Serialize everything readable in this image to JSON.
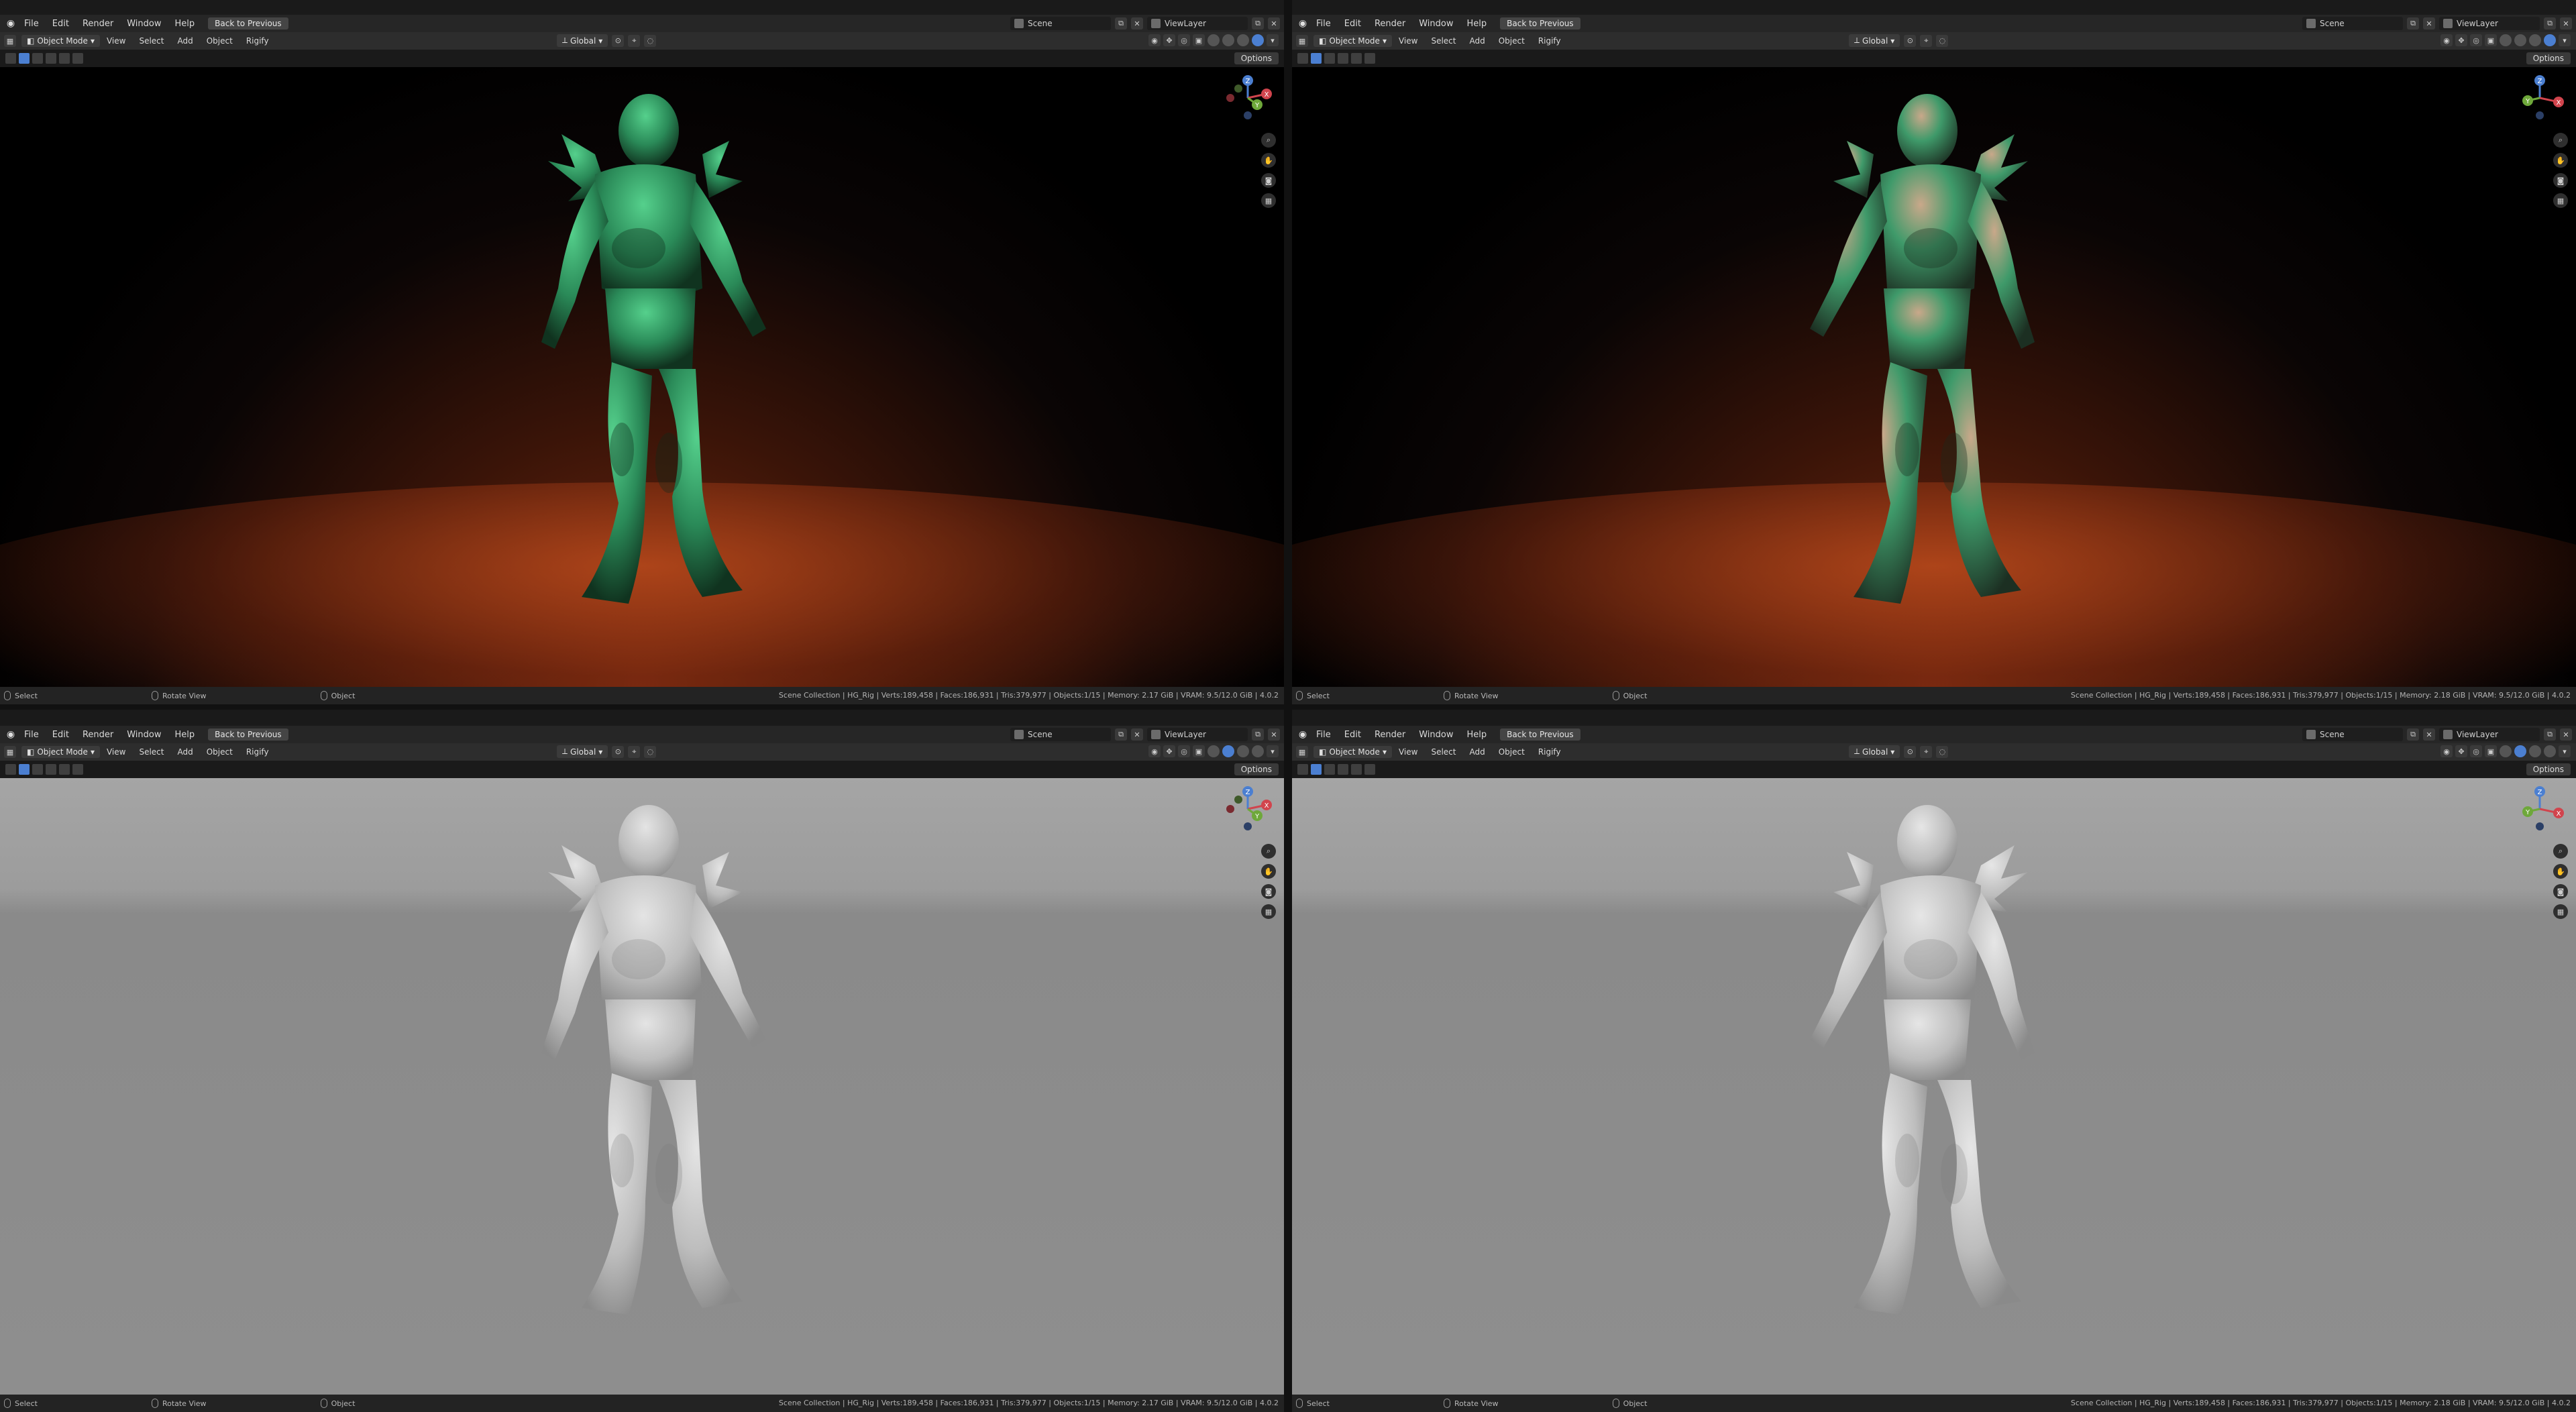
{
  "menu": {
    "file": "File",
    "edit": "Edit",
    "render": "Render",
    "window": "Window",
    "help": "Help",
    "back_to_previous": "Back to Previous"
  },
  "scene": {
    "scene_name": "Scene",
    "view_layer": "ViewLayer"
  },
  "header": {
    "mode": "Object Mode",
    "view": "View",
    "select": "Select",
    "add": "Add",
    "object": "Object",
    "rigify": "Rigify",
    "orientation": "Global",
    "options": "Options"
  },
  "status": {
    "select": "Select",
    "rotate_view": "Rotate View",
    "object": "Object",
    "stats_left": "Scene Collection | HG_Rig | Verts:189,458 | Faces:186,931 | Tris:379,977 | Objects:1/15 | Memory: 2.17 GiB | VRAM: 9.5/12.0 GiB | 4.0.2",
    "stats_right": "Scene Collection | HG_Rig | Verts:189,458 | Faces:186,931 | Tris:379,977 | Objects:1/15 | Memory: 2.18 GiB | VRAM: 9.5/12.0 GiB | 4.0.2"
  },
  "gizmo": {
    "z": "Z",
    "y": "Y",
    "x": "X"
  },
  "colors": {
    "accent": "#4b7fd1",
    "axis_x": "#d1444d",
    "axis_y": "#6ea83a",
    "axis_z": "#4b7fd1",
    "creature_rendered": "#2f9b63",
    "creature_clay": "#bdbdbd"
  },
  "icons": [
    "blender-icon",
    "search-icon",
    "hand-icon",
    "camera-icon",
    "grid-icon",
    "mouse-icon"
  ]
}
